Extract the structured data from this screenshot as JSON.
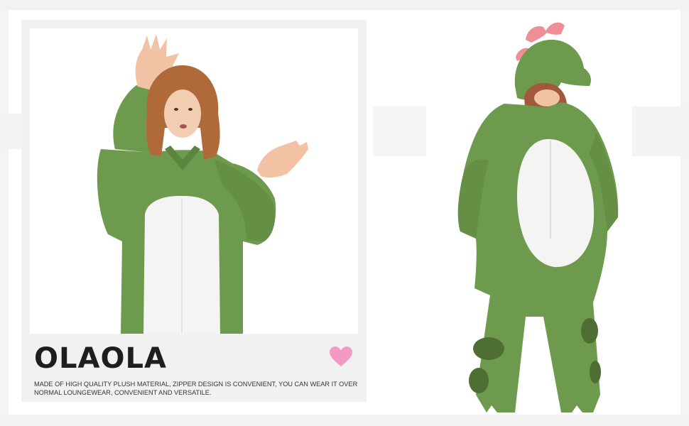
{
  "brand": {
    "name": "OLAOLA"
  },
  "description": "MADE OF HIGH QUALITY PLUSH MATERIAL, ZIPPER DESIGN IS CONVENIENT, YOU CAN WEAR IT OVER NORMAL LOUNGEWEAR, CONVENIENT AND VERSATILE.",
  "icons": {
    "heart": "heart-icon"
  },
  "colors": {
    "costume_green": "#6e9a4e",
    "belly_white": "#f4f4f2",
    "heart_pink": "#f39ac3",
    "knee_patch": "#4f6e34"
  }
}
